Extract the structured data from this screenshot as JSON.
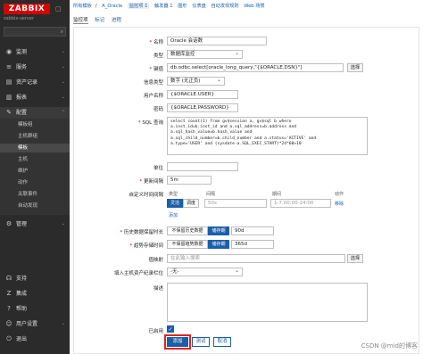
{
  "sidebar": {
    "logo": "ZABBIX",
    "server": "zabbix-server",
    "search_placeholder": "",
    "items": [
      {
        "icon": "eye-icon",
        "label": "监测",
        "expand": "⌄"
      },
      {
        "icon": "list-icon",
        "label": "服务",
        "expand": "⌄"
      },
      {
        "icon": "box-icon",
        "label": "资产记录",
        "expand": "⌄"
      },
      {
        "icon": "chart-icon",
        "label": "报表",
        "expand": "⌄"
      },
      {
        "icon": "wrench-icon",
        "label": "配置",
        "expand": "⌃"
      }
    ],
    "subitems": [
      "模板组",
      "主机群组",
      "模板",
      "主机",
      "维护",
      "动作",
      "关联事件",
      "自动发现"
    ],
    "bottom": [
      {
        "icon": "gear-icon",
        "label": "管理",
        "expand": "⌄"
      },
      {
        "icon": "headset-icon",
        "label": "支持"
      },
      {
        "icon": "z-icon",
        "label": "集成"
      },
      {
        "icon": "help-icon",
        "label": "帮助"
      },
      {
        "icon": "user-icon",
        "label": "用户设置",
        "expand": "⌄"
      },
      {
        "icon": "power-icon",
        "label": "退出"
      }
    ]
  },
  "breadcrumb": [
    "所有模板",
    "A_Oracle",
    "监控项 1",
    "触发器 1",
    "图形",
    "仪表盘",
    "自动发现规则",
    "Web 场景"
  ],
  "tabs": [
    "监控项",
    "标记",
    "进程"
  ],
  "form": {
    "name": {
      "label": "名称",
      "value": "Oracle 会话数"
    },
    "type": {
      "label": "类型",
      "value": "数据库监控"
    },
    "key": {
      "label": "键值",
      "value": "db.odbc.select[oracle_long_query,\"{$ORACLE.DSN}\"]",
      "btn": "选择"
    },
    "info_type": {
      "label": "信息类型",
      "value": "数字 (无正负)"
    },
    "username": {
      "label": "用户名称",
      "value": "{$ORACLE.USER}"
    },
    "password": {
      "label": "密码",
      "value": "{$ORACLE.PASSWORD}"
    },
    "sql": {
      "label": "SQL 查询",
      "lines": [
        "select count(1) from gv$session a, gv$sql b where",
        "a.inst_id=b.inst_id and a.sql_address=b.address and",
        "a.sql_hash_value=b.hash_value and",
        "a.sql_child_number=b.child_number and a.status='ACTIVE' and",
        "a.type='USER' and (sysdate-a.SQL_EXEC_START)*24*60>10"
      ]
    },
    "units": {
      "label": "单位",
      "value": ""
    },
    "interval": {
      "label": "更新间隔",
      "value": "5m"
    },
    "custom": {
      "label": "自定义时间间隔",
      "headers": [
        "类型",
        "间隔",
        "期间",
        "动作"
      ],
      "seg1": "灵活",
      "seg2": "调度",
      "interval_ph": "50s",
      "period_ph": "1-7,00:00-24:00",
      "remove": "移除",
      "add": "添加"
    },
    "history": {
      "label": "历史数据保留时长",
      "seg1": "不保留历史数据",
      "seg2": "储存期",
      "value": "90d"
    },
    "trends": {
      "label": "趋势存储时间",
      "seg1": "不保留趋势数据",
      "seg2": "储存期",
      "value": "365d"
    },
    "valuemap": {
      "label": "值映射",
      "placeholder": "在此输入搜索",
      "btn": "选择"
    },
    "inventory": {
      "label": "填入主机资产纪录栏位",
      "value": "-无-"
    },
    "desc": {
      "label": "描述",
      "value": ""
    },
    "enabled": {
      "label": "已启用"
    },
    "buttons": {
      "add": "添加",
      "test": "测试",
      "cancel": "取消"
    }
  },
  "watermark": "CSDN @mid的博客"
}
